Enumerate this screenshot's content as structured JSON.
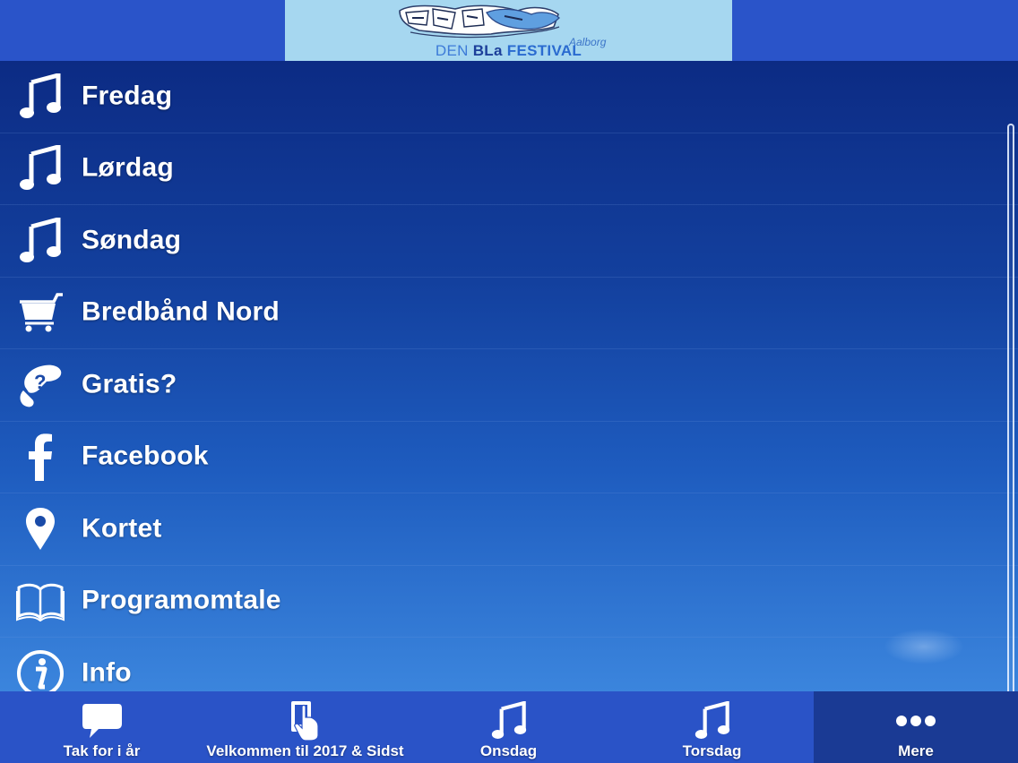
{
  "header": {
    "logo_text_den": "DEN",
    "logo_text_bla": "BLa",
    "logo_text_festival": "FESTIVAL",
    "logo_city": "Aalborg"
  },
  "menu": {
    "items": [
      {
        "label": "Fredag",
        "icon": "music-note-icon"
      },
      {
        "label": "Lørdag",
        "icon": "music-note-icon"
      },
      {
        "label": "Søndag",
        "icon": "music-note-icon"
      },
      {
        "label": "Bredbånd Nord",
        "icon": "shopping-cart-icon"
      },
      {
        "label": "Gratis?",
        "icon": "hand-question-icon"
      },
      {
        "label": "Facebook",
        "icon": "facebook-icon"
      },
      {
        "label": "Kortet",
        "icon": "map-pin-icon"
      },
      {
        "label": "Programomtale",
        "icon": "book-icon"
      },
      {
        "label": "Info",
        "icon": "info-icon"
      }
    ]
  },
  "tabbar": {
    "tabs": [
      {
        "label": "Tak for i år",
        "icon": "speech-bubble-icon"
      },
      {
        "label": "Velkommen til 2017 & Sidst",
        "icon": "tap-phone-icon"
      },
      {
        "label": "Onsdag",
        "icon": "music-note-icon"
      },
      {
        "label": "Torsdag",
        "icon": "music-note-icon"
      },
      {
        "label": "Mere",
        "icon": "more-dots-icon",
        "active": true
      }
    ]
  },
  "colors": {
    "header_bg": "#2a54c9",
    "logo_bg": "#a6d7f0",
    "tabbar_bg": "#2a53c7",
    "tab_active_bg": "#1a3a94",
    "text": "#ffffff"
  }
}
